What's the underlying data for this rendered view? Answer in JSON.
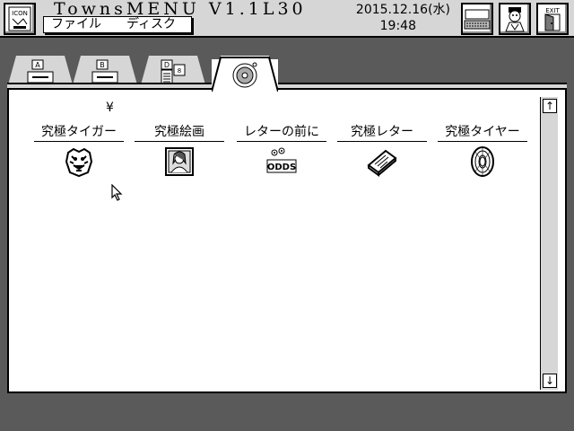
{
  "topbar": {
    "app_title": "TownsMENU  V1.1L30",
    "menu": [
      "ファイル",
      "ディスク"
    ],
    "date": "2015.12.16(水)",
    "time": "19:48",
    "icons": [
      "icon-editor-icon",
      "keyboard-icon",
      "user-icon",
      "exit-icon"
    ]
  },
  "tabs": [
    {
      "icon": "drive-a-icon"
    },
    {
      "icon": "drive-b-icon"
    },
    {
      "icon": "drive-d-icon"
    },
    {
      "icon": "cdrom-icon",
      "active": true
    }
  ],
  "window": {
    "path_symbol": "¥",
    "items": [
      {
        "label": "究極タイガー",
        "icon": "tiger-icon"
      },
      {
        "label": "究極絵画",
        "icon": "painting-icon"
      },
      {
        "label": "レターの前に",
        "icon": "odds-icon"
      },
      {
        "label": "究極レター",
        "icon": "letter-icon"
      },
      {
        "label": "究極タイヤー",
        "icon": "tire-icon"
      }
    ],
    "scroll_up": "↑",
    "scroll_down": "↓"
  }
}
